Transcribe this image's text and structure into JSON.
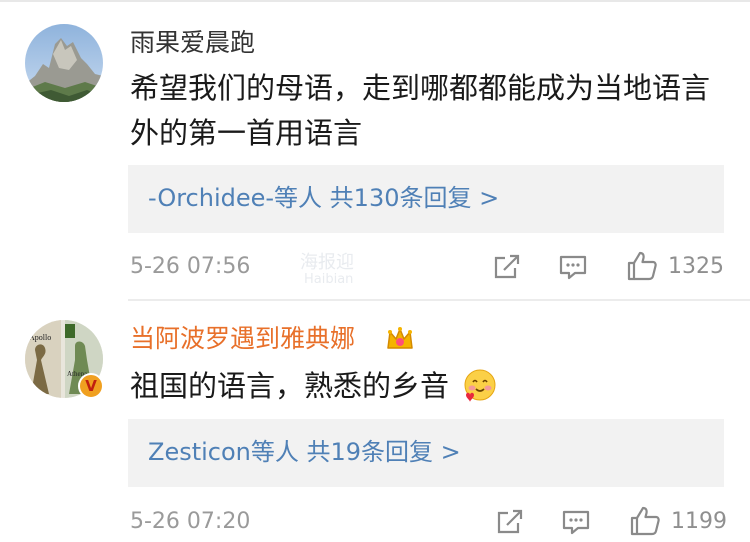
{
  "comments": [
    {
      "username": "雨果爱晨跑",
      "text": "希望我们的母语，走到哪都都能成为当地语言外的第一首用语言",
      "replies_label": "-Orchidee-等人 共130条回复 >",
      "time": "5-26 07:56",
      "like_count": "1325"
    },
    {
      "username": "当阿波罗遇到雅典娜",
      "text": "祖国的语言，熟悉的乡音",
      "replies_label": "Zesticon等人 共19条回复 >",
      "time": "5-26 07:20",
      "like_count": "1199",
      "avatar_text": {
        "apollo": "Apollo",
        "athena": "Athena"
      },
      "verified_badge": "V"
    }
  ],
  "watermark": {
    "cn": "海报迎",
    "en": "Haibian"
  },
  "colors": {
    "accent_link": "#4f80b6",
    "vip_username": "#e8702a",
    "normal_username": "#333333"
  },
  "icons": [
    "share-icon",
    "comment-icon",
    "like-icon",
    "crown-icon",
    "smiley-heart-emoji"
  ]
}
